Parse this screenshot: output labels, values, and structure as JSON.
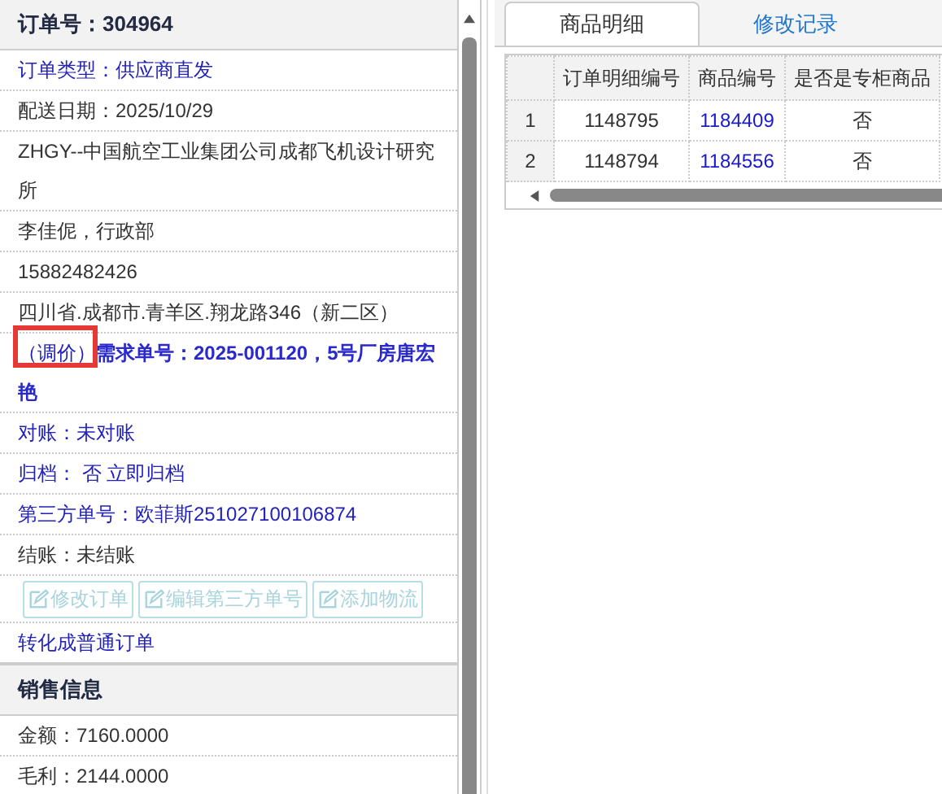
{
  "order_panel": {
    "title": "订单号：304964",
    "rows": [
      {
        "kind": "link",
        "text": "订单类型：供应商直发"
      },
      {
        "kind": "text",
        "text": "配送日期：2025/10/29"
      },
      {
        "kind": "text",
        "text": "ZHGY--中国航空工业集团公司成都飞机设计研究所"
      },
      {
        "kind": "text",
        "text": "李佳伲，行政部"
      },
      {
        "kind": "text",
        "text": "15882482426"
      },
      {
        "kind": "text",
        "text": "四川省.成都市.青羊区.翔龙路346（新二区）"
      },
      {
        "kind": "flagged",
        "flag": "（调价）",
        "text": "需求单号：2025-001120，5号厂房唐宏艳"
      },
      {
        "kind": "link",
        "text": "对账：未对账"
      },
      {
        "kind": "link",
        "text": "归档： 否 立即归档"
      },
      {
        "kind": "link",
        "text": "第三方单号：欧菲斯251027100106874"
      },
      {
        "kind": "text",
        "text": "结账：未结账"
      }
    ],
    "actions": [
      {
        "label": "修改订单",
        "disabled": true
      },
      {
        "label": "编辑第三方单号",
        "disabled": true
      },
      {
        "label": "添加物流",
        "disabled": true
      }
    ],
    "convert_link": "转化成普通订单"
  },
  "sales_section": {
    "title": "销售信息",
    "rows": [
      "金额：7160.0000",
      "毛利：2144.0000"
    ]
  },
  "tabs": [
    {
      "label": "商品明细",
      "selected": true
    },
    {
      "label": "修改记录",
      "selected": false
    }
  ],
  "table": {
    "columns": [
      "订单明细编号",
      "商品编号",
      "是否是专柜商品"
    ],
    "rows": [
      {
        "index": "1",
        "cells": [
          "1148795",
          "1184409",
          "否"
        ]
      },
      {
        "index": "2",
        "cells": [
          "1148794",
          "1184556",
          "否"
        ]
      }
    ]
  }
}
